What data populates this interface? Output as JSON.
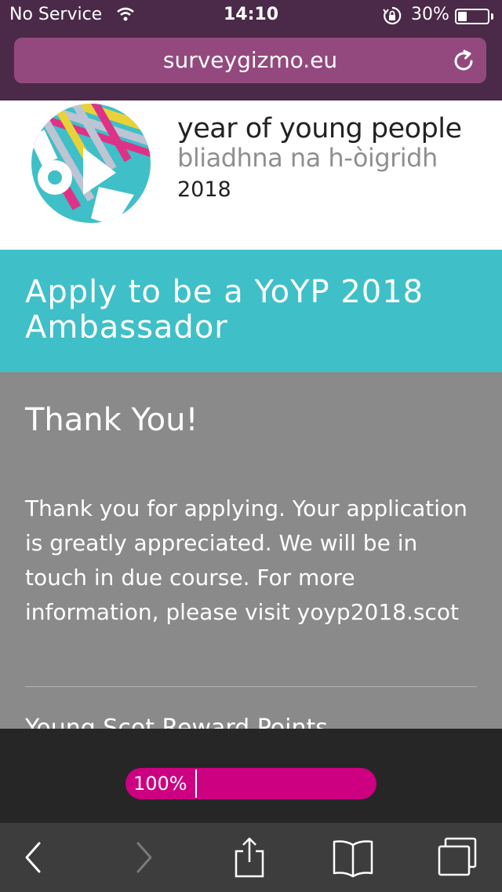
{
  "status_bar": {
    "carrier": "No Service",
    "time": "14:10",
    "battery": "30%",
    "battery_level": 0.3
  },
  "browser": {
    "url": "surveygizmo.eu"
  },
  "logo": {
    "line1": "year of young people",
    "line2": "bliadhna na h-òigridh",
    "line3": "2018"
  },
  "page": {
    "title": "Apply to be a YoYP 2018 Ambassador",
    "heading": "Thank You!",
    "message": "Thank you for applying. Your application is greatly appreciated. We will be in touch in due course. For more information, please visit yoyp2018.scot",
    "next_heading": "Young Scot Reward Points"
  },
  "progress": {
    "label": "100%",
    "value": 1.0,
    "color": "#cc0080"
  },
  "toolbar": {
    "icons": [
      "back-icon",
      "forward-icon",
      "share-icon",
      "bookmarks-icon",
      "tabs-icon"
    ]
  },
  "colors": {
    "status_bg": "#4a2a48",
    "url_bar": "#93497e",
    "title_band": "#3fbfc8",
    "content_bg": "#8a8a8a"
  }
}
